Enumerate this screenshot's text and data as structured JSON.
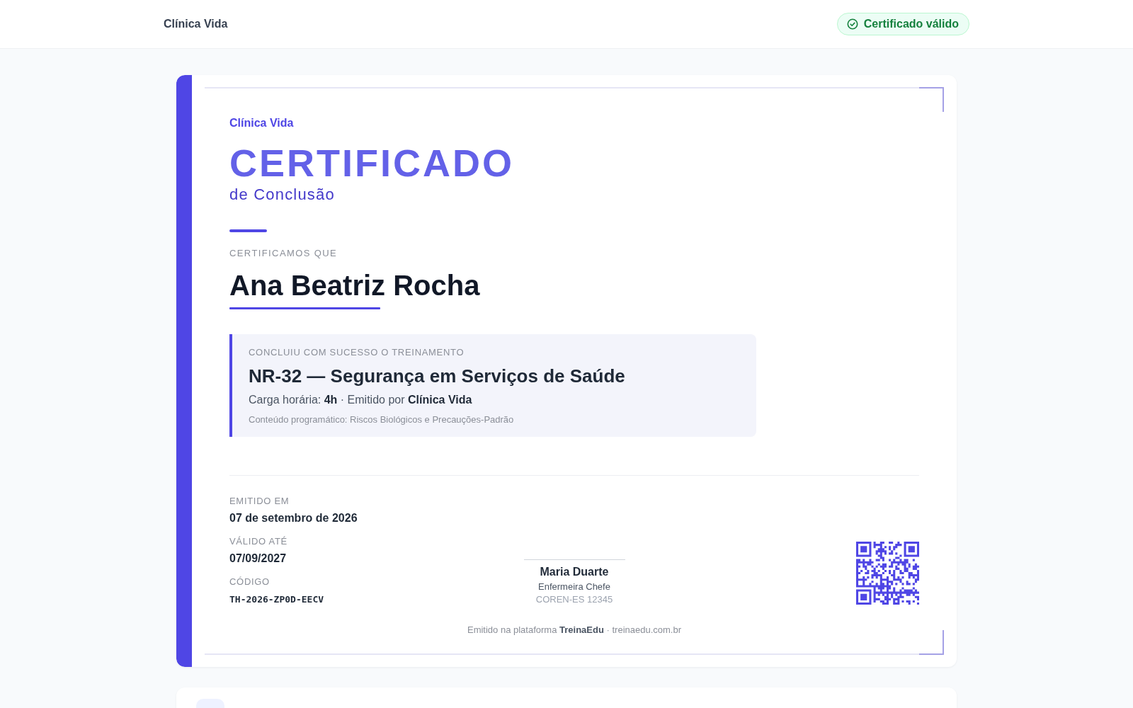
{
  "header": {
    "brand": "Clínica Vida",
    "status_badge": {
      "label": "Certificado válido"
    }
  },
  "certificate": {
    "issuer": "Clínica Vida",
    "title": "CERTIFICADO",
    "subtitle": "de Conclusão",
    "intro": "CERTIFICAMOS QUE",
    "recipient": "Ana Beatriz Rocha",
    "course": {
      "label": "CONCLUIU COM SUCESSO O TREINAMENTO",
      "name": "NR-32 — Segurança em Serviços de Saúde",
      "details": "Carga horária: **4h** · Emitido por **Clínica Vida**",
      "syllabus": "Conteúdo programático: Riscos Biológicos e Precauções-Padrão"
    },
    "fields": [
      {
        "label": "EMITIDO EM",
        "value": "07 de setembro de 2026",
        "kind": "text"
      },
      {
        "label": "VÁLIDO ATÉ",
        "value": "07/09/2027",
        "kind": "text"
      },
      {
        "label": "CÓDIGO",
        "value": "TH-2026-ZP0D-EECV",
        "kind": "code"
      }
    ],
    "signature": {
      "name": "Maria Duarte",
      "role": "Enfermeira Chefe",
      "registration": "COREN-ES 12345"
    },
    "footer": "Emitido na plataforma **TreinaEdu** · treinaedu.com.br"
  }
}
